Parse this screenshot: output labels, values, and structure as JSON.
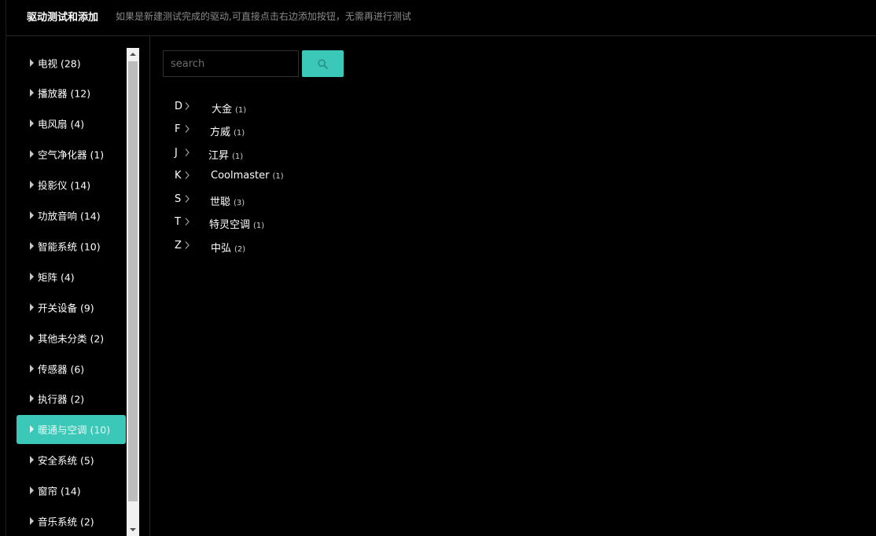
{
  "header": {
    "title": "驱动测试和添加",
    "description": "如果是新建测试完成的驱动,可直接点击右边添加按钮，无需再进行测试"
  },
  "sidebar": {
    "items": [
      {
        "label": "电视 (28)",
        "active": false
      },
      {
        "label": "播放器 (12)",
        "active": false
      },
      {
        "label": "电风扇 (4)",
        "active": false
      },
      {
        "label": "空气净化器 (1)",
        "active": false
      },
      {
        "label": "投影仪 (14)",
        "active": false
      },
      {
        "label": "功放音响 (14)",
        "active": false
      },
      {
        "label": "智能系统 (10)",
        "active": false
      },
      {
        "label": "矩阵 (4)",
        "active": false
      },
      {
        "label": "开关设备 (9)",
        "active": false
      },
      {
        "label": "其他未分类 (2)",
        "active": false
      },
      {
        "label": "传感器 (6)",
        "active": false
      },
      {
        "label": "执行器 (2)",
        "active": false
      },
      {
        "label": "暖通与空调 (10)",
        "active": true
      },
      {
        "label": "安全系统 (5)",
        "active": false
      },
      {
        "label": "窗帘 (14)",
        "active": false
      },
      {
        "label": "音乐系统 (2)",
        "active": false
      }
    ]
  },
  "search": {
    "placeholder": "search",
    "value": ""
  },
  "brands": [
    {
      "letter": "D",
      "name": "大金",
      "count": "(1)"
    },
    {
      "letter": "F",
      "name": "方威",
      "count": "(1)"
    },
    {
      "letter": "J",
      "name": "江昇",
      "count": "(1)"
    },
    {
      "letter": "K",
      "name": "Coolmaster",
      "count": "(1)"
    },
    {
      "letter": "S",
      "name": "世聪",
      "count": "(3)"
    },
    {
      "letter": "T",
      "name": "特灵空调",
      "count": "(1)"
    },
    {
      "letter": "Z",
      "name": "中弘",
      "count": "(2)"
    }
  ],
  "colors": {
    "accent": "#3cc8b8",
    "background": "#000000"
  },
  "icons": {
    "search": "search-icon",
    "chevron": "chevron-right-icon",
    "caret": "caret-right-icon"
  }
}
